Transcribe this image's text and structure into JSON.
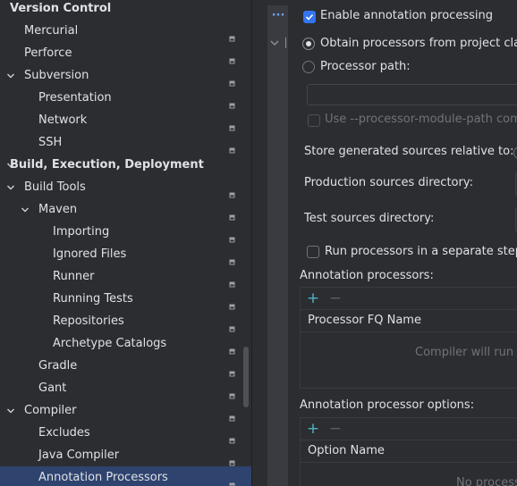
{
  "tree": {
    "items": [
      {
        "label": "Version Control",
        "level": 0,
        "bold": true,
        "expandable": false,
        "expanded": false,
        "selected": false,
        "project_icon": false
      },
      {
        "label": "Mercurial",
        "level": 1,
        "bold": false,
        "expandable": false,
        "expanded": false,
        "selected": false,
        "project_icon": true
      },
      {
        "label": "Perforce",
        "level": 1,
        "bold": false,
        "expandable": false,
        "expanded": false,
        "selected": false,
        "project_icon": true
      },
      {
        "label": "Subversion",
        "level": 1,
        "bold": false,
        "expandable": true,
        "expanded": true,
        "selected": false,
        "project_icon": true
      },
      {
        "label": "Presentation",
        "level": 2,
        "bold": false,
        "expandable": false,
        "expanded": false,
        "selected": false,
        "project_icon": true
      },
      {
        "label": "Network",
        "level": 2,
        "bold": false,
        "expandable": false,
        "expanded": false,
        "selected": false,
        "project_icon": true
      },
      {
        "label": "SSH",
        "level": 2,
        "bold": false,
        "expandable": false,
        "expanded": false,
        "selected": false,
        "project_icon": true
      },
      {
        "label": "Build, Execution, Deployment",
        "level": 0,
        "bold": true,
        "expandable": true,
        "expanded": true,
        "selected": false,
        "project_icon": false
      },
      {
        "label": "Build Tools",
        "level": 1,
        "bold": false,
        "expandable": true,
        "expanded": true,
        "selected": false,
        "project_icon": true
      },
      {
        "label": "Maven",
        "level": 2,
        "bold": false,
        "expandable": true,
        "expanded": true,
        "selected": false,
        "project_icon": true
      },
      {
        "label": "Importing",
        "level": 3,
        "bold": false,
        "expandable": false,
        "expanded": false,
        "selected": false,
        "project_icon": true
      },
      {
        "label": "Ignored Files",
        "level": 3,
        "bold": false,
        "expandable": false,
        "expanded": false,
        "selected": false,
        "project_icon": true
      },
      {
        "label": "Runner",
        "level": 3,
        "bold": false,
        "expandable": false,
        "expanded": false,
        "selected": false,
        "project_icon": true
      },
      {
        "label": "Running Tests",
        "level": 3,
        "bold": false,
        "expandable": false,
        "expanded": false,
        "selected": false,
        "project_icon": true
      },
      {
        "label": "Repositories",
        "level": 3,
        "bold": false,
        "expandable": false,
        "expanded": false,
        "selected": false,
        "project_icon": true
      },
      {
        "label": "Archetype Catalogs",
        "level": 3,
        "bold": false,
        "expandable": false,
        "expanded": false,
        "selected": false,
        "project_icon": true
      },
      {
        "label": "Gradle",
        "level": 2,
        "bold": false,
        "expandable": false,
        "expanded": false,
        "selected": false,
        "project_icon": true
      },
      {
        "label": "Gant",
        "level": 2,
        "bold": false,
        "expandable": false,
        "expanded": false,
        "selected": false,
        "project_icon": true
      },
      {
        "label": "Compiler",
        "level": 1,
        "bold": false,
        "expandable": true,
        "expanded": true,
        "selected": false,
        "project_icon": true
      },
      {
        "label": "Excludes",
        "level": 2,
        "bold": false,
        "expandable": false,
        "expanded": false,
        "selected": false,
        "project_icon": true
      },
      {
        "label": "Java Compiler",
        "level": 2,
        "bold": false,
        "expandable": false,
        "expanded": false,
        "selected": false,
        "project_icon": true
      },
      {
        "label": "Annotation Processors",
        "level": 2,
        "bold": false,
        "expandable": false,
        "expanded": false,
        "selected": true,
        "project_icon": true
      }
    ]
  },
  "strip": {
    "more_label": "···"
  },
  "content": {
    "enable_processing": {
      "label": "Enable annotation processing",
      "checked": true
    },
    "obtain_from_classpath": {
      "label": "Obtain processors from project clas",
      "selected": true
    },
    "processor_path": {
      "label": "Processor path:",
      "selected": false,
      "value": ""
    },
    "module_path": {
      "label": "Use --processor-module-path com",
      "checked": false,
      "enabled": false
    },
    "store_relative": {
      "label": "Store generated sources relative to:"
    },
    "production_dir": {
      "label": "Production sources directory:"
    },
    "test_dir": {
      "label": "Test sources directory:"
    },
    "separate_step": {
      "label": "Run processors in a separate step",
      "checked": false
    },
    "processors_table": {
      "title": "Annotation processors:",
      "add_label": "+",
      "remove_label": "−",
      "column": "Processor FQ Name",
      "empty_text": "Compiler will run a"
    },
    "options_table": {
      "title": "Annotation processor options:",
      "add_label": "+",
      "remove_label": "−",
      "column": "Option Name",
      "empty_text": "No process"
    }
  },
  "colors": {
    "background": "#2b2d30",
    "selection": "#2e436e",
    "accent": "#3574f0",
    "add_button": "#4eb3c3",
    "disabled_text": "#6f737a"
  }
}
